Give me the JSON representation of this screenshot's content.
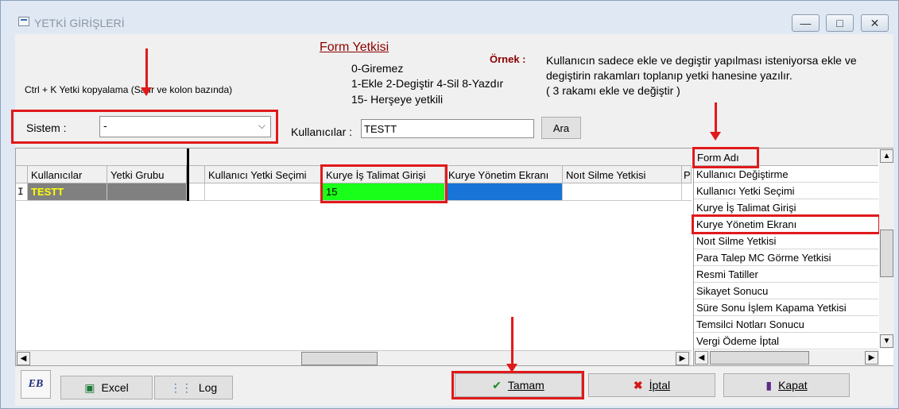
{
  "window": {
    "title": "YETKİ GİRİŞLERİ",
    "minimize": "—",
    "maximize": "□",
    "close": "✕"
  },
  "legend": {
    "title": "Form Yetkisi",
    "line1": "0-Giremez",
    "line2": "1-Ekle  2-Degiştir  4-Sil  8-Yazdır",
    "line3": "15- Herşeye yetkili"
  },
  "example": {
    "label": "Örnek :",
    "text": "Kullanıcın sadece ekle ve degiştir yapılması isteniyorsa  ekle ve degiştirin rakamları toplanıp yetki hanesine yazılır.\n ( 3 rakamı ekle ve değiştir )"
  },
  "ctrl_note": "Ctrl + K Yetki kopyalama (Satır ve kolon bazında)",
  "sistem": {
    "label": "Sistem :",
    "value": "-"
  },
  "kullanicilar": {
    "label": "Kullanıcılar :",
    "value": "TESTT",
    "search_button": "Ara"
  },
  "grid": {
    "columns": [
      "Kullanıcılar",
      "Yetki Grubu",
      "",
      "Kullanıcı Yetki Seçimi",
      "Kurye İş Talimat Girişi",
      "Kurye Yönetim Ekranı",
      "Noıt Silme Yetkisi",
      "P"
    ],
    "row": {
      "indicator": "I",
      "user": "TESTT",
      "group": "",
      "value": "15"
    },
    "colors": {
      "selected_value_bg": "#1aff1a",
      "selected_cell_bg": "#1874d6",
      "user_text": "#ffff00",
      "row_bg": "#808080"
    }
  },
  "form_list": {
    "header": "Form Adı",
    "items": [
      "Kullanıcı Değiştirme",
      "Kullanıcı Yetki Seçimi",
      "Kurye İş Talimat Girişi",
      "Kurye Yönetim Ekranı",
      "Noıt Silme Yetkisi",
      "Para Talep MC Görme Yetkisi",
      "Resmi Tatiller",
      "Sikayet Sonucu",
      "Süre Sonu İşlem Kapama Yetkisi",
      "Temsilci Notları Sonucu",
      "Vergi Ödeme İptal"
    ]
  },
  "buttons": {
    "logo": "EB",
    "excel": "Excel",
    "log": "Log",
    "ok": "Tamam",
    "cancel": "İptal",
    "close": "Kapat"
  },
  "highlight_color": "#e0191b"
}
